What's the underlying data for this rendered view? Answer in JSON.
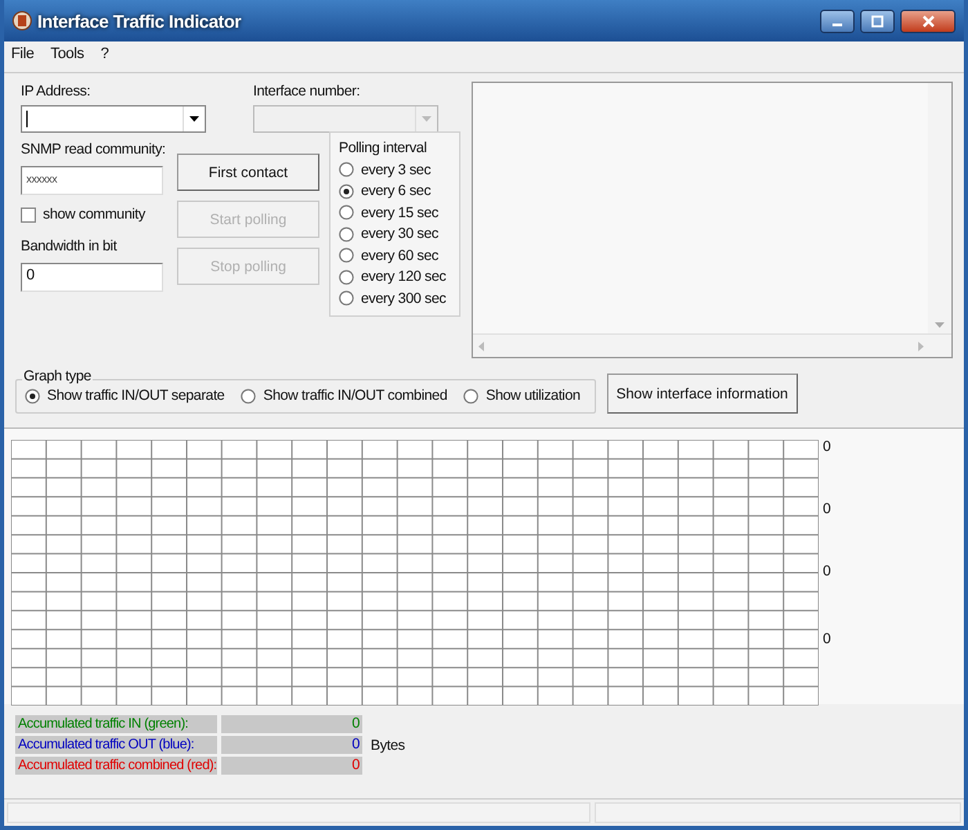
{
  "window": {
    "title": "Interface Traffic Indicator"
  },
  "menu": [
    {
      "label": "File"
    },
    {
      "label": "Tools"
    },
    {
      "label": "?"
    }
  ],
  "ip_address": {
    "label": "IP Address:"
  },
  "interface_number": {
    "label": "Interface number:",
    "disabled": true
  },
  "snmp_community": {
    "label": "SNMP read community:",
    "value": "xxxxxx"
  },
  "show_community": {
    "label": "show community",
    "checked": false
  },
  "bandwidth": {
    "label": "Bandwidth in bit",
    "value": "0"
  },
  "buttons": [
    {
      "label": "First contact",
      "disabled": false
    },
    {
      "label": "Start polling",
      "disabled": true
    },
    {
      "label": "Stop polling",
      "disabled": true
    }
  ],
  "polling_interval": {
    "title": "Polling interval",
    "options": [
      {
        "label": "every 3 sec",
        "selected": false
      },
      {
        "label": "every 6 sec",
        "selected": true
      },
      {
        "label": "every 15 sec",
        "selected": false
      },
      {
        "label": "every 30 sec",
        "selected": false
      },
      {
        "label": "every 60 sec",
        "selected": false
      },
      {
        "label": "every 120 sec",
        "selected": false
      },
      {
        "label": "every 300 sec",
        "selected": false
      }
    ]
  },
  "graph_type": {
    "title": "Graph type",
    "options": [
      {
        "label": "Show traffic IN/OUT separate",
        "selected": true
      },
      {
        "label": "Show traffic IN/OUT combined",
        "selected": false
      },
      {
        "label": "Show utilization",
        "selected": false
      }
    ]
  },
  "info_button": {
    "label": "Show interface information"
  },
  "graph": {
    "axis_labels": [
      "0",
      "0",
      "0",
      "0"
    ]
  },
  "totals": [
    {
      "label": "Accumulated traffic IN (green):",
      "value": "0",
      "color": "#008000"
    },
    {
      "label": "Accumulated traffic OUT (blue):",
      "value": "0",
      "unit": "Bytes",
      "color": "#0000c0"
    },
    {
      "label": "Accumulated traffic combined (red):",
      "value": "0",
      "color": "#e00000"
    }
  ]
}
